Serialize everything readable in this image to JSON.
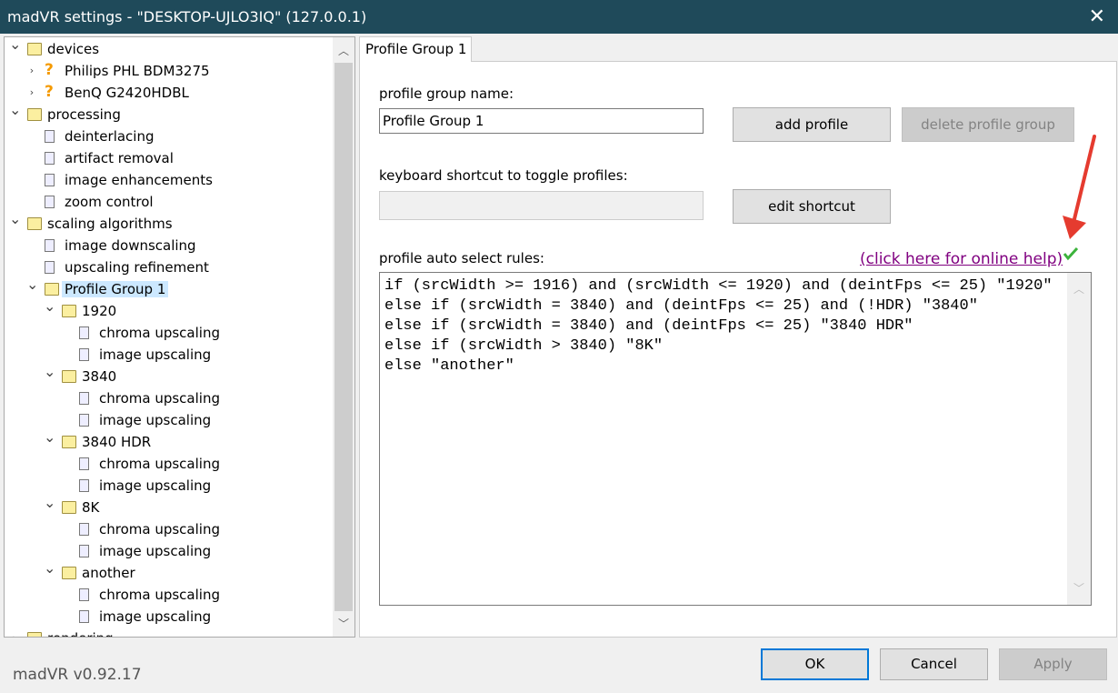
{
  "window": {
    "title": "madVR settings - \"DESKTOP-UJLO3IQ\" (127.0.0.1)",
    "close_icon": "close-icon"
  },
  "tree": [
    {
      "label": "devices",
      "level": 0,
      "icon": "folder",
      "chevron": "down"
    },
    {
      "label": "Philips PHL BDM3275",
      "level": 1,
      "icon": "question",
      "chevron": "right"
    },
    {
      "label": "BenQ G2420HDBL",
      "level": 1,
      "icon": "question",
      "chevron": "right"
    },
    {
      "label": "processing",
      "level": 0,
      "icon": "folder",
      "chevron": "down"
    },
    {
      "label": "deinterlacing",
      "level": 1,
      "icon": "doc"
    },
    {
      "label": "artifact removal",
      "level": 1,
      "icon": "doc"
    },
    {
      "label": "image enhancements",
      "level": 1,
      "icon": "doc"
    },
    {
      "label": "zoom control",
      "level": 1,
      "icon": "doc"
    },
    {
      "label": "scaling algorithms",
      "level": 0,
      "icon": "folder",
      "chevron": "down"
    },
    {
      "label": "image downscaling",
      "level": 1,
      "icon": "doc"
    },
    {
      "label": "upscaling refinement",
      "level": 1,
      "icon": "doc"
    },
    {
      "label": "Profile Group 1",
      "level": 1,
      "icon": "folder-open",
      "chevron": "down",
      "selected": true
    },
    {
      "label": "1920",
      "level": 2,
      "icon": "folder",
      "chevron": "down"
    },
    {
      "label": "chroma upscaling",
      "level": 3,
      "icon": "doc"
    },
    {
      "label": "image upscaling",
      "level": 3,
      "icon": "doc"
    },
    {
      "label": "3840",
      "level": 2,
      "icon": "folder",
      "chevron": "down"
    },
    {
      "label": "chroma upscaling",
      "level": 3,
      "icon": "doc"
    },
    {
      "label": "image upscaling",
      "level": 3,
      "icon": "doc"
    },
    {
      "label": "3840 HDR",
      "level": 2,
      "icon": "folder",
      "chevron": "down"
    },
    {
      "label": "chroma upscaling",
      "level": 3,
      "icon": "doc"
    },
    {
      "label": "image upscaling",
      "level": 3,
      "icon": "doc"
    },
    {
      "label": "8K",
      "level": 2,
      "icon": "folder",
      "chevron": "down"
    },
    {
      "label": "chroma upscaling",
      "level": 3,
      "icon": "doc"
    },
    {
      "label": "image upscaling",
      "level": 3,
      "icon": "doc"
    },
    {
      "label": "another",
      "level": 2,
      "icon": "folder",
      "chevron": "down"
    },
    {
      "label": "chroma upscaling",
      "level": 3,
      "icon": "doc"
    },
    {
      "label": "image upscaling",
      "level": 3,
      "icon": "doc"
    },
    {
      "label": "rendering",
      "level": 0,
      "icon": "folder",
      "chevron": "right"
    }
  ],
  "tab": {
    "label": "Profile Group 1"
  },
  "form": {
    "name_label": "profile group name:",
    "name_value": "Profile Group 1",
    "add_profile": "add profile",
    "delete_group": "delete profile group",
    "shortcut_label": "keyboard shortcut to toggle profiles:",
    "shortcut_value": "",
    "edit_shortcut": "edit shortcut",
    "rules_label": "profile auto select rules:",
    "help_link": "(click here for online help)",
    "rules": "if (srcWidth >= 1916) and (srcWidth <= 1920) and (deintFps <= 25) \"1920\"\nelse if (srcWidth = 3840) and (deintFps <= 25) and (!HDR) \"3840\"\nelse if (srcWidth = 3840) and (deintFps <= 25) \"3840 HDR\"\nelse if (srcWidth > 3840) \"8K\"\nelse \"another\""
  },
  "footer": {
    "version": "madVR v0.92.17",
    "ok": "OK",
    "cancel": "Cancel",
    "apply": "Apply"
  },
  "colors": {
    "titlebar": "#1f4a5a",
    "selection": "#cce8ff",
    "link": "#800080",
    "annotation_arrow": "#e53b2f"
  }
}
